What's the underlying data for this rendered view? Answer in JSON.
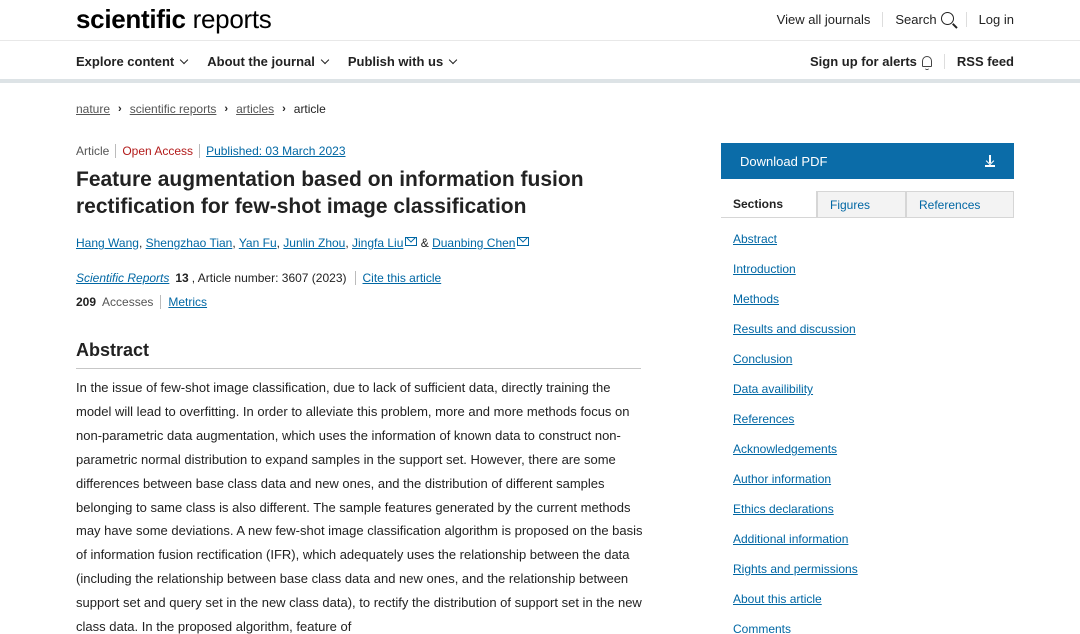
{
  "header": {
    "logo_bold": "scientific",
    "logo_light": "reports",
    "view_all": "View all journals",
    "search": "Search",
    "login": "Log in"
  },
  "nav": {
    "explore": "Explore content",
    "about": "About the journal",
    "publish": "Publish with us",
    "alerts": "Sign up for alerts",
    "rss": "RSS feed"
  },
  "breadcrumb": {
    "items": [
      "nature",
      "scientific reports",
      "articles",
      "article"
    ]
  },
  "article": {
    "type": "Article",
    "access": "Open Access",
    "published": "Published: 03 March 2023",
    "title": "Feature augmentation based on information fusion rectification for few-shot image classification",
    "authors": [
      "Hang Wang",
      "Shengzhao Tian",
      "Yan Fu",
      "Junlin Zhou",
      "Jingfa Liu",
      "Duanbing Chen"
    ],
    "author_sep": ", ",
    "author_and": " & ",
    "journal": "Scientific Reports",
    "volume": "13",
    "article_number": ", Article number: 3607 (2023)",
    "cite": "Cite this article",
    "accesses_count": "209",
    "accesses_label": "Accesses",
    "metrics": "Metrics",
    "abstract_heading": "Abstract",
    "abstract_text": "In the issue of few-shot image classification, due to lack of sufficient data, directly training the model will lead to overfitting. In order to alleviate this problem, more and more methods focus on non-parametric data augmentation, which uses the information of known data to construct non-parametric normal distribution to expand samples in the support set. However, there are some differences between base class data and new ones, and the distribution of different samples belonging to same class is also different. The sample features generated by the current methods may have some deviations. A new few-shot image classification algorithm is proposed on the basis of information fusion rectification (IFR), which adequately uses the relationship between the data (including the relationship between base class data and new ones, and the relationship between support set and query set in the new class data), to rectify the distribution of support set in the new class data. In the proposed algorithm, feature of"
  },
  "sidebar": {
    "download": "Download PDF",
    "tabs": [
      "Sections",
      "Figures",
      "References"
    ],
    "sections": [
      "Abstract",
      "Introduction",
      "Methods",
      "Results and discussion",
      "Conclusion",
      "Data availibility",
      "References",
      "Acknowledgements",
      "Author information",
      "Ethics declarations",
      "Additional information",
      "Rights and permissions",
      "About this article",
      "Comments"
    ]
  },
  "colors": {
    "accent": "#0b6ca8",
    "link": "#0067a4",
    "open_access": "#b31b1b"
  }
}
